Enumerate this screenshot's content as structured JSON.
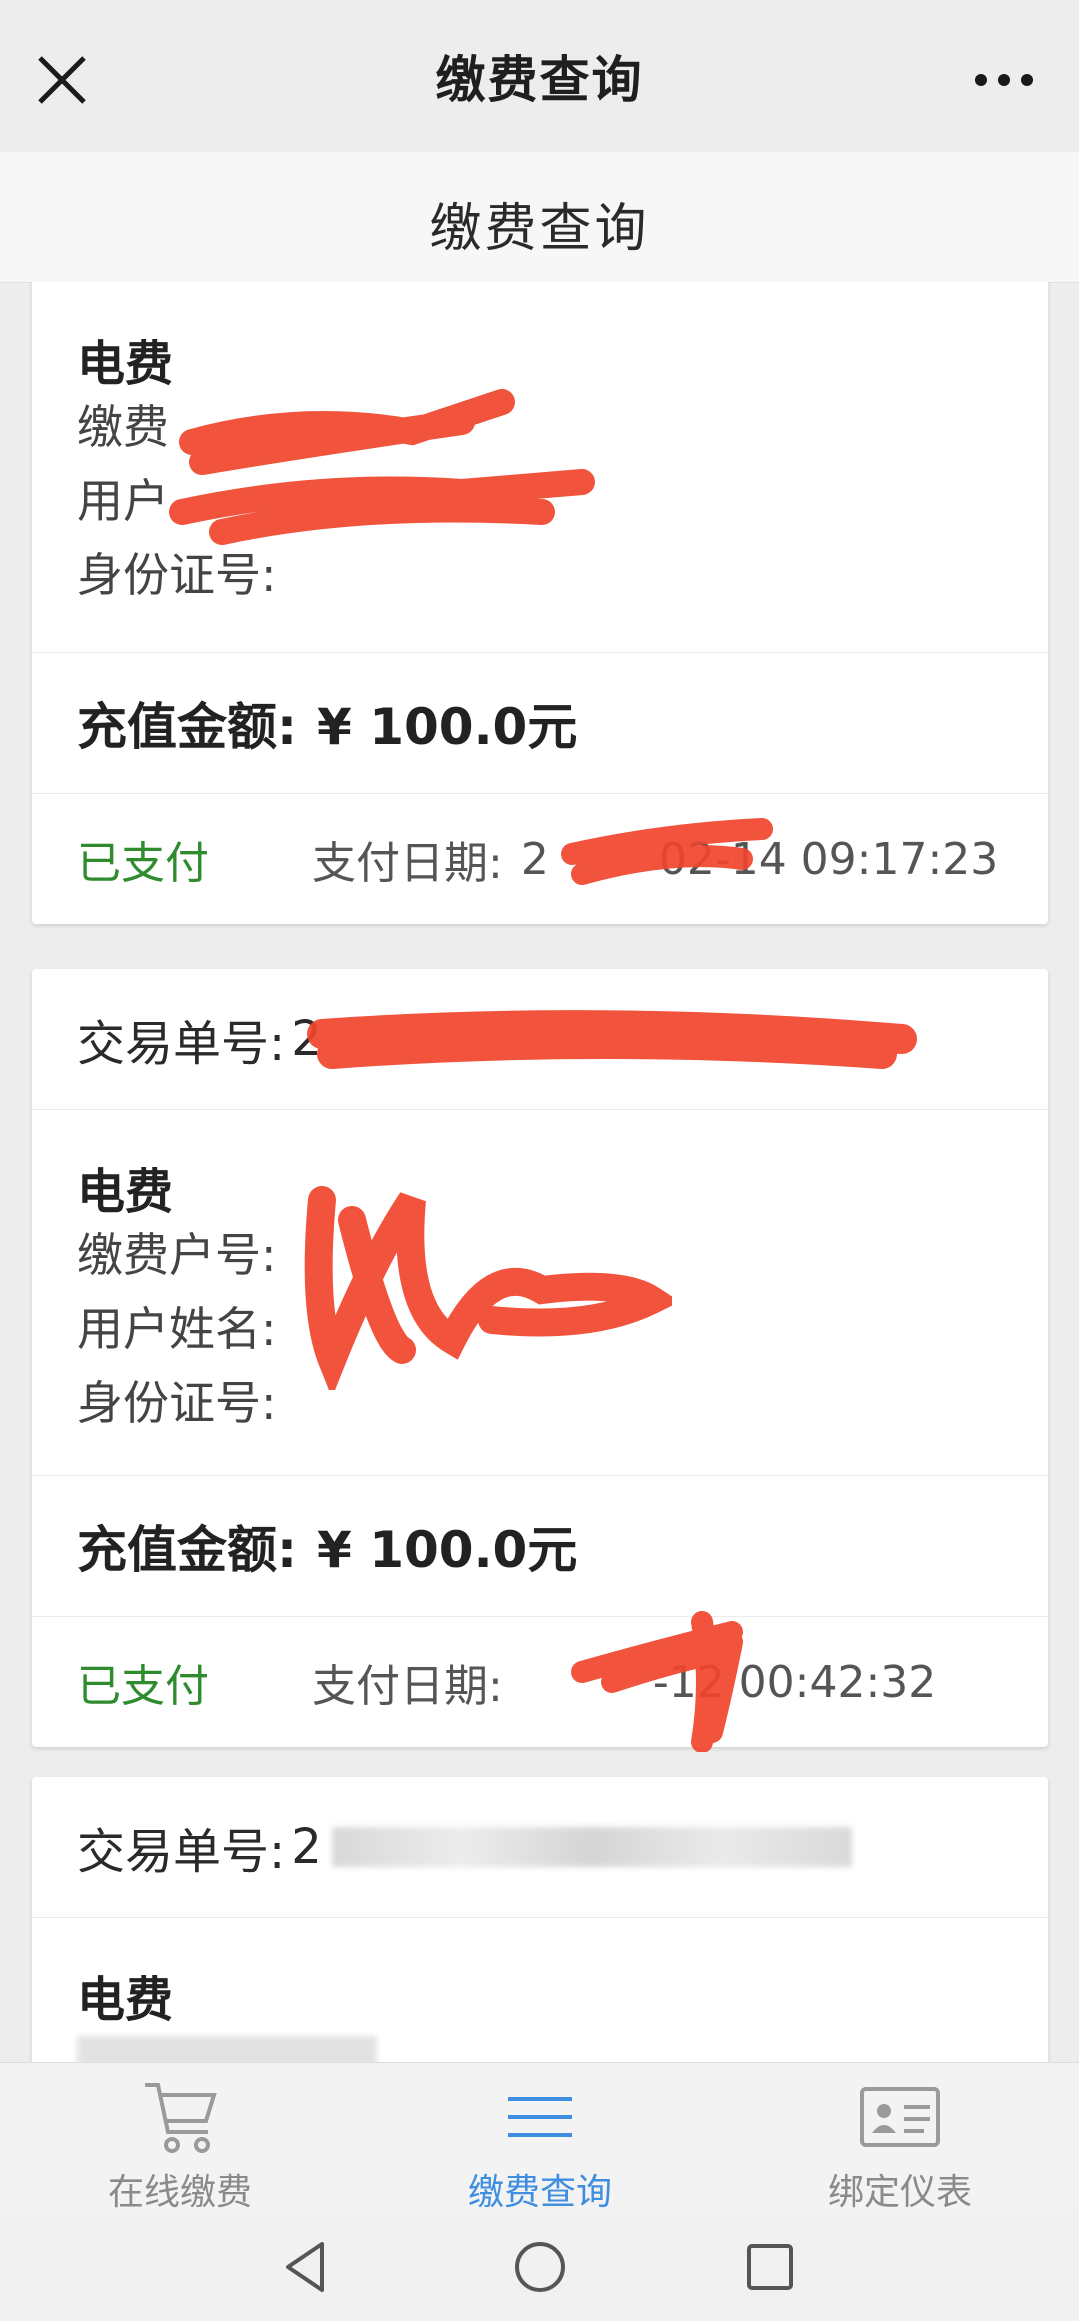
{
  "header": {
    "title": "缴费查询",
    "close_icon": "close-icon",
    "more_icon": "more-icon"
  },
  "subheader": {
    "title": "缴费查询"
  },
  "records": [
    {
      "type": "电费",
      "account_label": "缴费",
      "name_label": "用户",
      "id_label": "身份证号:",
      "amount_label": "充值金额:",
      "amount": "¥ 100.0元",
      "status": "已支付",
      "date_label": "支付日期:",
      "date": "2",
      "date_tail": "02-14 09:17:23"
    },
    {
      "txn_label": "交易单号:",
      "txn_value": "2",
      "type": "电费",
      "account_label": "缴费户号:",
      "name_label": "用户姓名:",
      "id_label": "身份证号:",
      "amount_label": "充值金额:",
      "amount": "¥ 100.0元",
      "status": "已支付",
      "date_label": "支付日期:",
      "date_tail": "-12 00:42:32"
    },
    {
      "txn_label": "交易单号:",
      "txn_value": "2",
      "type": "电费"
    }
  ],
  "tabs": [
    {
      "label": "在线缴费",
      "icon": "cart-icon",
      "active": false
    },
    {
      "label": "缴费查询",
      "icon": "list-icon",
      "active": true
    },
    {
      "label": "绑定仪表",
      "icon": "id-card-icon",
      "active": false
    }
  ],
  "colors": {
    "paid": "#2e8b2e",
    "active_tab": "#3f8ee0",
    "redaction": "#f0442c"
  }
}
